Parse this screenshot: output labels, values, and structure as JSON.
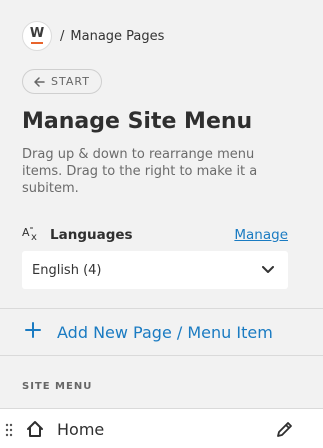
{
  "header": {
    "logo_letter": "W",
    "breadcrumb_separator": "/",
    "breadcrumb_current": "Manage Pages"
  },
  "start_button": {
    "label": "START",
    "icon": "arrow-left-icon"
  },
  "page": {
    "title": "Manage Site Menu",
    "description": "Drag up & down to rearrange menu items. Drag to the right to make it a subitem."
  },
  "languages": {
    "label": "Languages",
    "icon": "translate-icon",
    "manage_link": "Manage",
    "selected": "English (4)"
  },
  "add_item": {
    "label": "Add New Page / Menu Item",
    "icon": "plus-icon"
  },
  "site_menu": {
    "section_label": "SITE MENU",
    "items": [
      {
        "label": "Home",
        "icon": "home-icon"
      }
    ]
  },
  "colors": {
    "background": "#f2f2f2",
    "accent_blue": "#1a7bc2",
    "logo_orange": "#e8642c"
  }
}
